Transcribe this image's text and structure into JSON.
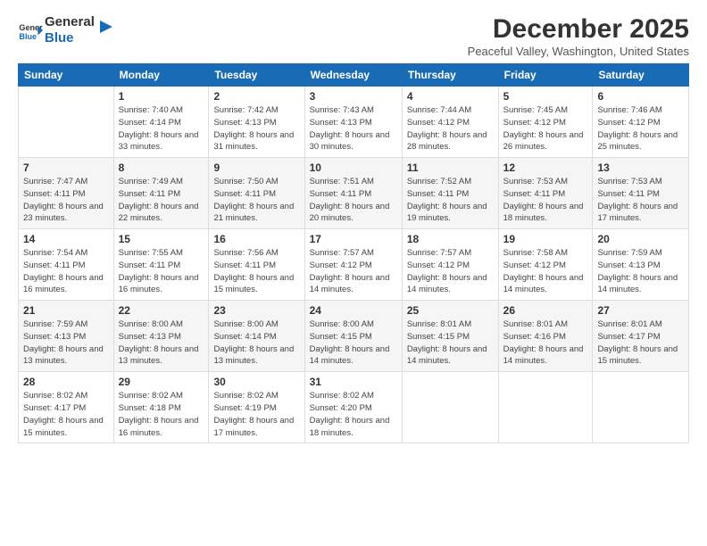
{
  "logo": {
    "line1": "General",
    "line2": "Blue",
    "icon": "▶"
  },
  "title": "December 2025",
  "location": "Peaceful Valley, Washington, United States",
  "weekdays": [
    "Sunday",
    "Monday",
    "Tuesday",
    "Wednesday",
    "Thursday",
    "Friday",
    "Saturday"
  ],
  "weeks": [
    [
      {
        "num": "",
        "sunrise": "",
        "sunset": "",
        "daylight": "",
        "empty": true
      },
      {
        "num": "1",
        "sunrise": "Sunrise: 7:40 AM",
        "sunset": "Sunset: 4:14 PM",
        "daylight": "Daylight: 8 hours and 33 minutes."
      },
      {
        "num": "2",
        "sunrise": "Sunrise: 7:42 AM",
        "sunset": "Sunset: 4:13 PM",
        "daylight": "Daylight: 8 hours and 31 minutes."
      },
      {
        "num": "3",
        "sunrise": "Sunrise: 7:43 AM",
        "sunset": "Sunset: 4:13 PM",
        "daylight": "Daylight: 8 hours and 30 minutes."
      },
      {
        "num": "4",
        "sunrise": "Sunrise: 7:44 AM",
        "sunset": "Sunset: 4:12 PM",
        "daylight": "Daylight: 8 hours and 28 minutes."
      },
      {
        "num": "5",
        "sunrise": "Sunrise: 7:45 AM",
        "sunset": "Sunset: 4:12 PM",
        "daylight": "Daylight: 8 hours and 26 minutes."
      },
      {
        "num": "6",
        "sunrise": "Sunrise: 7:46 AM",
        "sunset": "Sunset: 4:12 PM",
        "daylight": "Daylight: 8 hours and 25 minutes."
      }
    ],
    [
      {
        "num": "7",
        "sunrise": "Sunrise: 7:47 AM",
        "sunset": "Sunset: 4:11 PM",
        "daylight": "Daylight: 8 hours and 23 minutes."
      },
      {
        "num": "8",
        "sunrise": "Sunrise: 7:49 AM",
        "sunset": "Sunset: 4:11 PM",
        "daylight": "Daylight: 8 hours and 22 minutes."
      },
      {
        "num": "9",
        "sunrise": "Sunrise: 7:50 AM",
        "sunset": "Sunset: 4:11 PM",
        "daylight": "Daylight: 8 hours and 21 minutes."
      },
      {
        "num": "10",
        "sunrise": "Sunrise: 7:51 AM",
        "sunset": "Sunset: 4:11 PM",
        "daylight": "Daylight: 8 hours and 20 minutes."
      },
      {
        "num": "11",
        "sunrise": "Sunrise: 7:52 AM",
        "sunset": "Sunset: 4:11 PM",
        "daylight": "Daylight: 8 hours and 19 minutes."
      },
      {
        "num": "12",
        "sunrise": "Sunrise: 7:53 AM",
        "sunset": "Sunset: 4:11 PM",
        "daylight": "Daylight: 8 hours and 18 minutes."
      },
      {
        "num": "13",
        "sunrise": "Sunrise: 7:53 AM",
        "sunset": "Sunset: 4:11 PM",
        "daylight": "Daylight: 8 hours and 17 minutes."
      }
    ],
    [
      {
        "num": "14",
        "sunrise": "Sunrise: 7:54 AM",
        "sunset": "Sunset: 4:11 PM",
        "daylight": "Daylight: 8 hours and 16 minutes."
      },
      {
        "num": "15",
        "sunrise": "Sunrise: 7:55 AM",
        "sunset": "Sunset: 4:11 PM",
        "daylight": "Daylight: 8 hours and 16 minutes."
      },
      {
        "num": "16",
        "sunrise": "Sunrise: 7:56 AM",
        "sunset": "Sunset: 4:11 PM",
        "daylight": "Daylight: 8 hours and 15 minutes."
      },
      {
        "num": "17",
        "sunrise": "Sunrise: 7:57 AM",
        "sunset": "Sunset: 4:12 PM",
        "daylight": "Daylight: 8 hours and 14 minutes."
      },
      {
        "num": "18",
        "sunrise": "Sunrise: 7:57 AM",
        "sunset": "Sunset: 4:12 PM",
        "daylight": "Daylight: 8 hours and 14 minutes."
      },
      {
        "num": "19",
        "sunrise": "Sunrise: 7:58 AM",
        "sunset": "Sunset: 4:12 PM",
        "daylight": "Daylight: 8 hours and 14 minutes."
      },
      {
        "num": "20",
        "sunrise": "Sunrise: 7:59 AM",
        "sunset": "Sunset: 4:13 PM",
        "daylight": "Daylight: 8 hours and 14 minutes."
      }
    ],
    [
      {
        "num": "21",
        "sunrise": "Sunrise: 7:59 AM",
        "sunset": "Sunset: 4:13 PM",
        "daylight": "Daylight: 8 hours and 13 minutes."
      },
      {
        "num": "22",
        "sunrise": "Sunrise: 8:00 AM",
        "sunset": "Sunset: 4:13 PM",
        "daylight": "Daylight: 8 hours and 13 minutes."
      },
      {
        "num": "23",
        "sunrise": "Sunrise: 8:00 AM",
        "sunset": "Sunset: 4:14 PM",
        "daylight": "Daylight: 8 hours and 13 minutes."
      },
      {
        "num": "24",
        "sunrise": "Sunrise: 8:00 AM",
        "sunset": "Sunset: 4:15 PM",
        "daylight": "Daylight: 8 hours and 14 minutes."
      },
      {
        "num": "25",
        "sunrise": "Sunrise: 8:01 AM",
        "sunset": "Sunset: 4:15 PM",
        "daylight": "Daylight: 8 hours and 14 minutes."
      },
      {
        "num": "26",
        "sunrise": "Sunrise: 8:01 AM",
        "sunset": "Sunset: 4:16 PM",
        "daylight": "Daylight: 8 hours and 14 minutes."
      },
      {
        "num": "27",
        "sunrise": "Sunrise: 8:01 AM",
        "sunset": "Sunset: 4:17 PM",
        "daylight": "Daylight: 8 hours and 15 minutes."
      }
    ],
    [
      {
        "num": "28",
        "sunrise": "Sunrise: 8:02 AM",
        "sunset": "Sunset: 4:17 PM",
        "daylight": "Daylight: 8 hours and 15 minutes."
      },
      {
        "num": "29",
        "sunrise": "Sunrise: 8:02 AM",
        "sunset": "Sunset: 4:18 PM",
        "daylight": "Daylight: 8 hours and 16 minutes."
      },
      {
        "num": "30",
        "sunrise": "Sunrise: 8:02 AM",
        "sunset": "Sunset: 4:19 PM",
        "daylight": "Daylight: 8 hours and 17 minutes."
      },
      {
        "num": "31",
        "sunrise": "Sunrise: 8:02 AM",
        "sunset": "Sunset: 4:20 PM",
        "daylight": "Daylight: 8 hours and 18 minutes."
      },
      {
        "num": "",
        "sunrise": "",
        "sunset": "",
        "daylight": "",
        "empty": true
      },
      {
        "num": "",
        "sunrise": "",
        "sunset": "",
        "daylight": "",
        "empty": true
      },
      {
        "num": "",
        "sunrise": "",
        "sunset": "",
        "daylight": "",
        "empty": true
      }
    ]
  ]
}
